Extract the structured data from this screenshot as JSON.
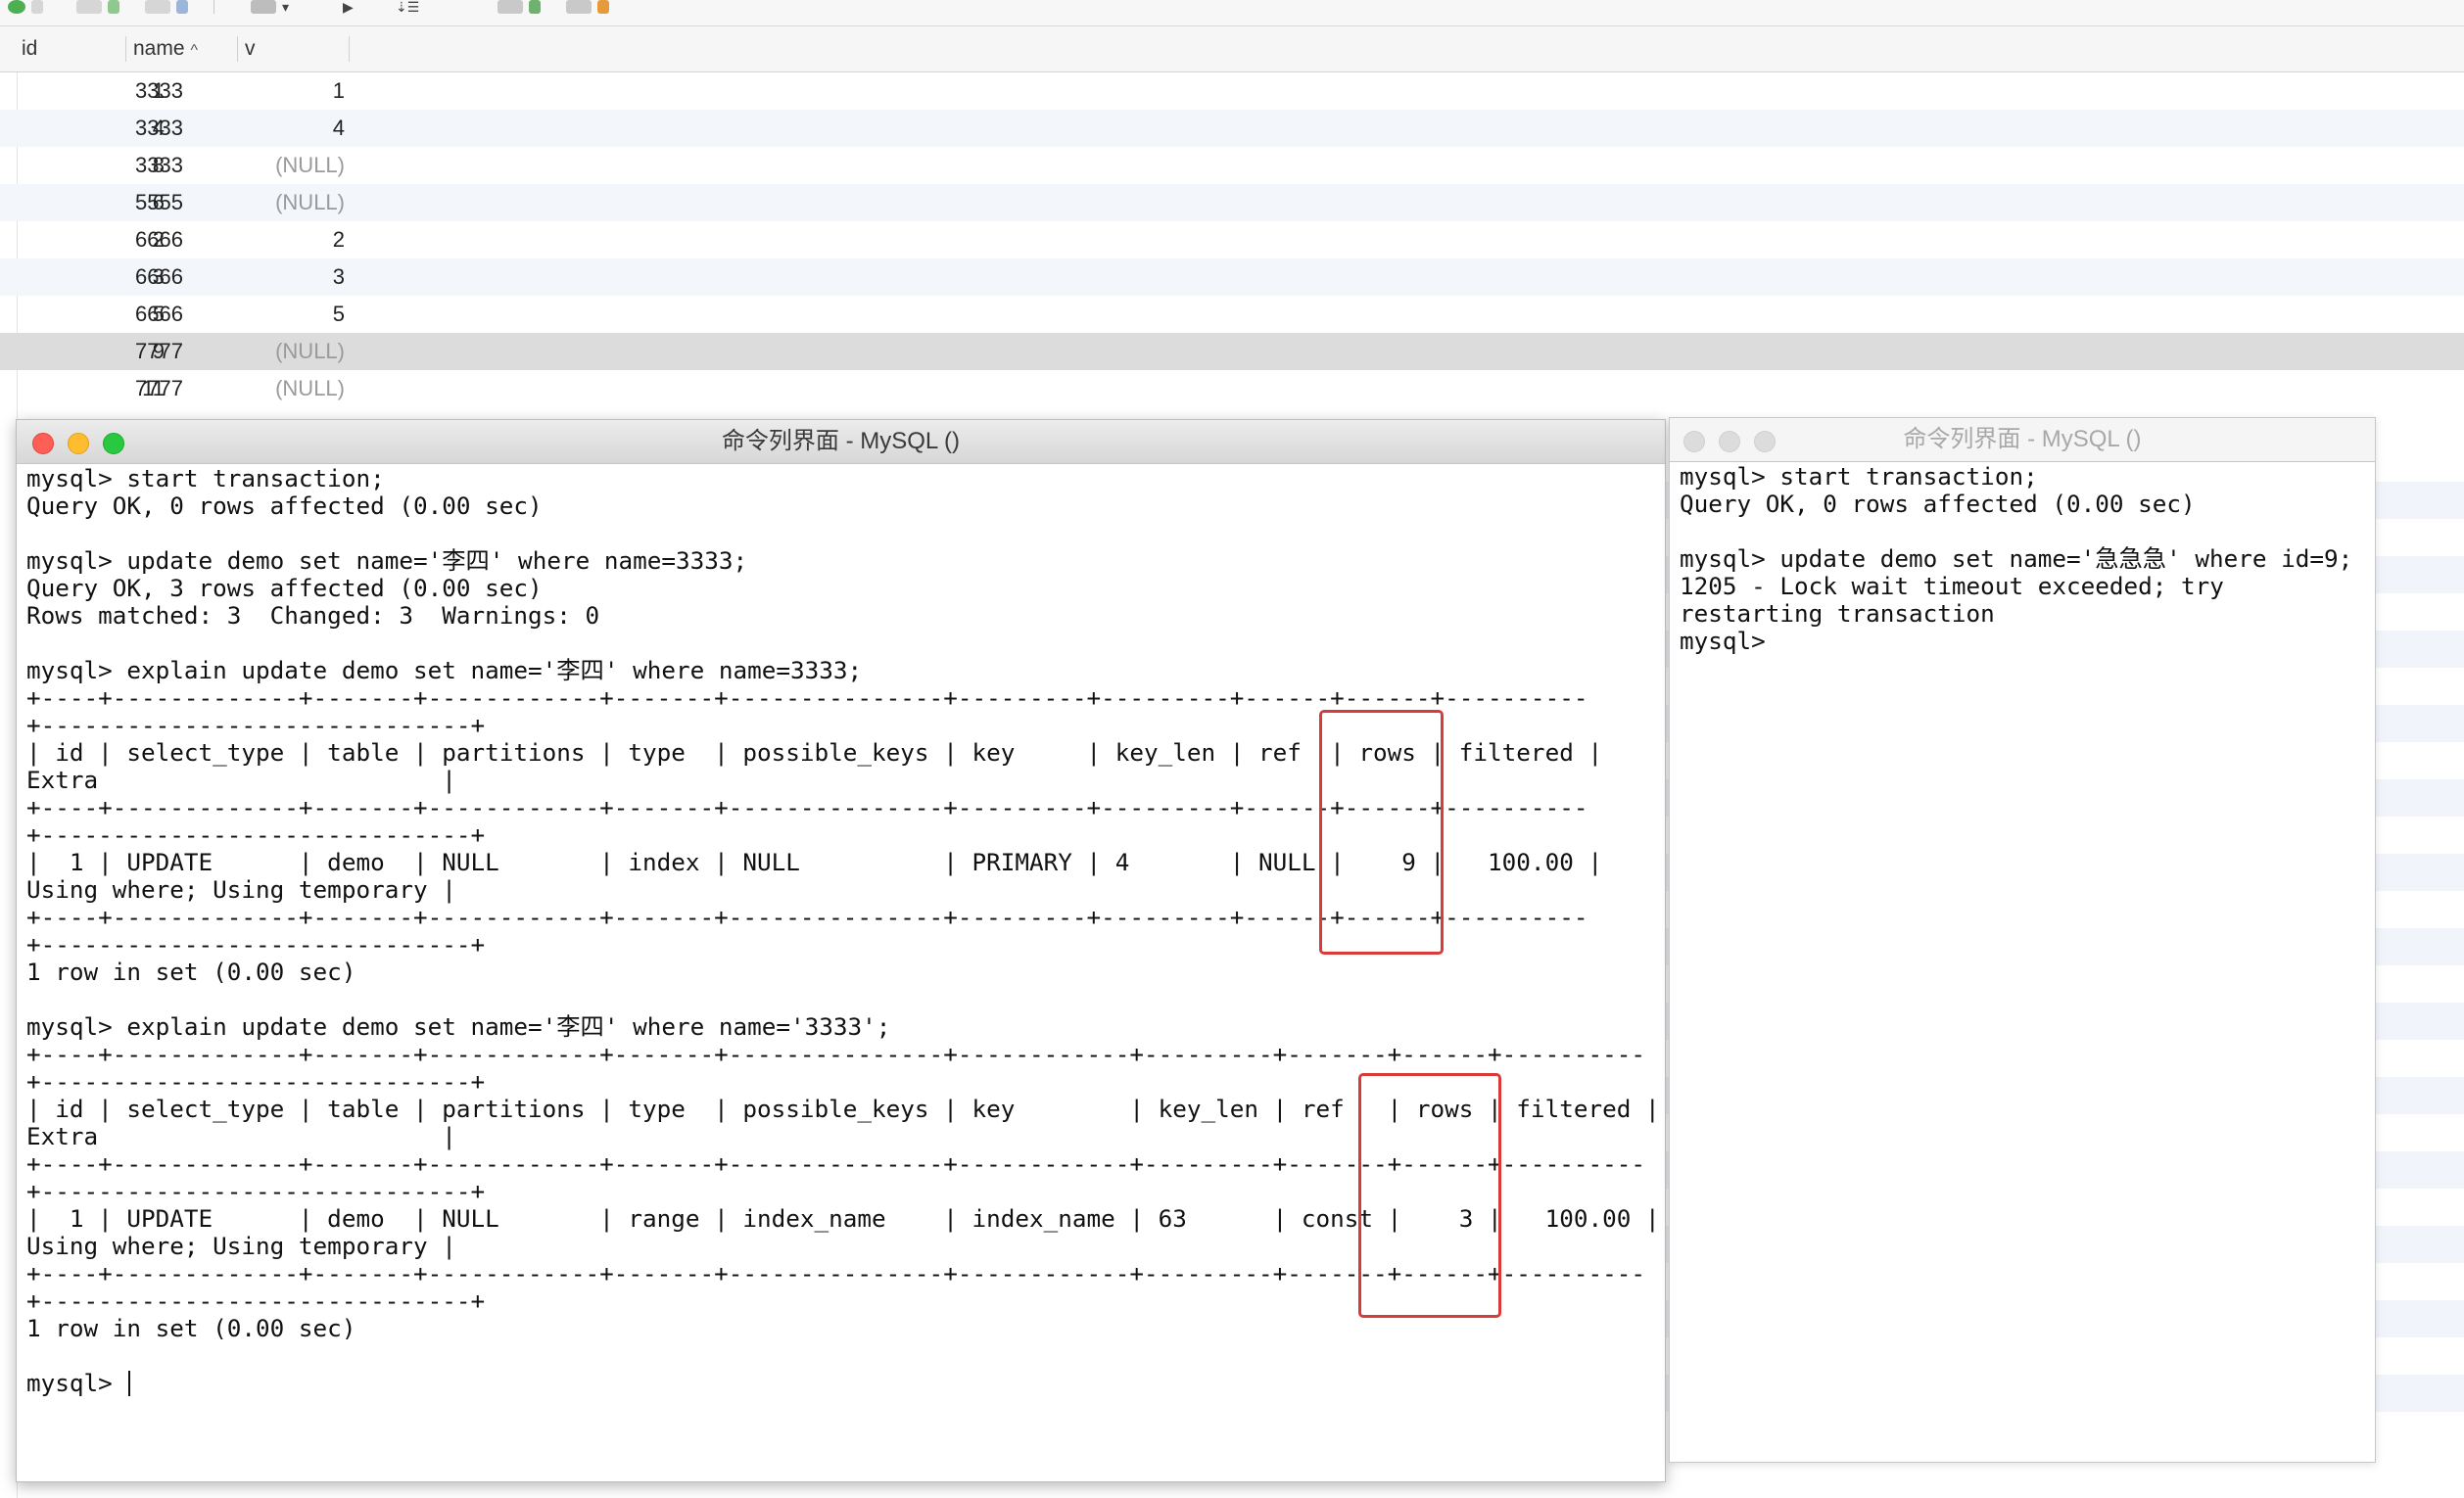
{
  "toolbar": {
    "icons": [
      "run-icon",
      "commit-icon",
      "refresh-icon",
      "text-view-icon",
      "dropdown-icon",
      "play-icon",
      "sort-icon",
      "import-icon",
      "export-icon"
    ]
  },
  "grid": {
    "columns": [
      "id",
      "name",
      "v"
    ],
    "sort_column": "name",
    "rows": [
      {
        "id": "1",
        "name": "3333",
        "v": "1"
      },
      {
        "id": "4",
        "name": "3333",
        "v": "4"
      },
      {
        "id": "8",
        "name": "3333",
        "v": "(NULL)"
      },
      {
        "id": "6",
        "name": "5555",
        "v": "(NULL)"
      },
      {
        "id": "2",
        "name": "6666",
        "v": "2"
      },
      {
        "id": "3",
        "name": "6666",
        "v": "3"
      },
      {
        "id": "5",
        "name": "6666",
        "v": "5"
      },
      {
        "id": "9",
        "name": "7777",
        "v": "(NULL)"
      },
      {
        "id": "11",
        "name": "7777",
        "v": "(NULL)"
      }
    ],
    "selected_row": 7
  },
  "terminal_left": {
    "title": "命令列界面 - MySQL ()",
    "content": "mysql> start transaction;\nQuery OK, 0 rows affected (0.00 sec)\n\nmysql> update demo set name='李四' where name=3333;\nQuery OK, 3 rows affected (0.00 sec)\nRows matched: 3  Changed: 3  Warnings: 0\n\nmysql> explain update demo set name='李四' where name=3333;\n+----+-------------+-------+------------+-------+---------------+---------+---------+------+------+----------\n+------------------------------+\n| id | select_type | table | partitions | type  | possible_keys | key     | key_len | ref  | rows | filtered |\nExtra                        |\n+----+-------------+-------+------------+-------+---------------+---------+---------+------+------+----------\n+------------------------------+\n|  1 | UPDATE      | demo  | NULL       | index | NULL          | PRIMARY | 4       | NULL |    9 |   100.00 |\nUsing where; Using temporary |\n+----+-------------+-------+------------+-------+---------------+---------+---------+------+------+----------\n+------------------------------+\n1 row in set (0.00 sec)\n\nmysql> explain update demo set name='李四' where name='3333';\n+----+-------------+-------+------------+-------+---------------+------------+---------+-------+------+----------\n+------------------------------+\n| id | select_type | table | partitions | type  | possible_keys | key        | key_len | ref   | rows | filtered |\nExtra                        |\n+----+-------------+-------+------------+-------+---------------+------------+---------+-------+------+----------\n+------------------------------+\n|  1 | UPDATE      | demo  | NULL       | range | index_name    | index_name | 63      | const |    3 |   100.00 |\nUsing where; Using temporary |\n+----+-------------+-------+------------+-------+---------------+------------+---------+-------+------+----------\n+------------------------------+\n1 row in set (0.00 sec)\n\n",
    "prompt": "mysql> "
  },
  "terminal_right": {
    "title": "命令列界面 - MySQL ()",
    "content": "mysql> start transaction;\nQuery OK, 0 rows affected (0.00 sec)\n\nmysql> update demo set name='急急急' where id=9;\n1205 - Lock wait timeout exceeded; try\nrestarting transaction\nmysql> "
  },
  "colors": {
    "highlight_box": "#d93a3a",
    "null_text": "#9a9a9a",
    "selected_row": "#dcdcdc"
  }
}
